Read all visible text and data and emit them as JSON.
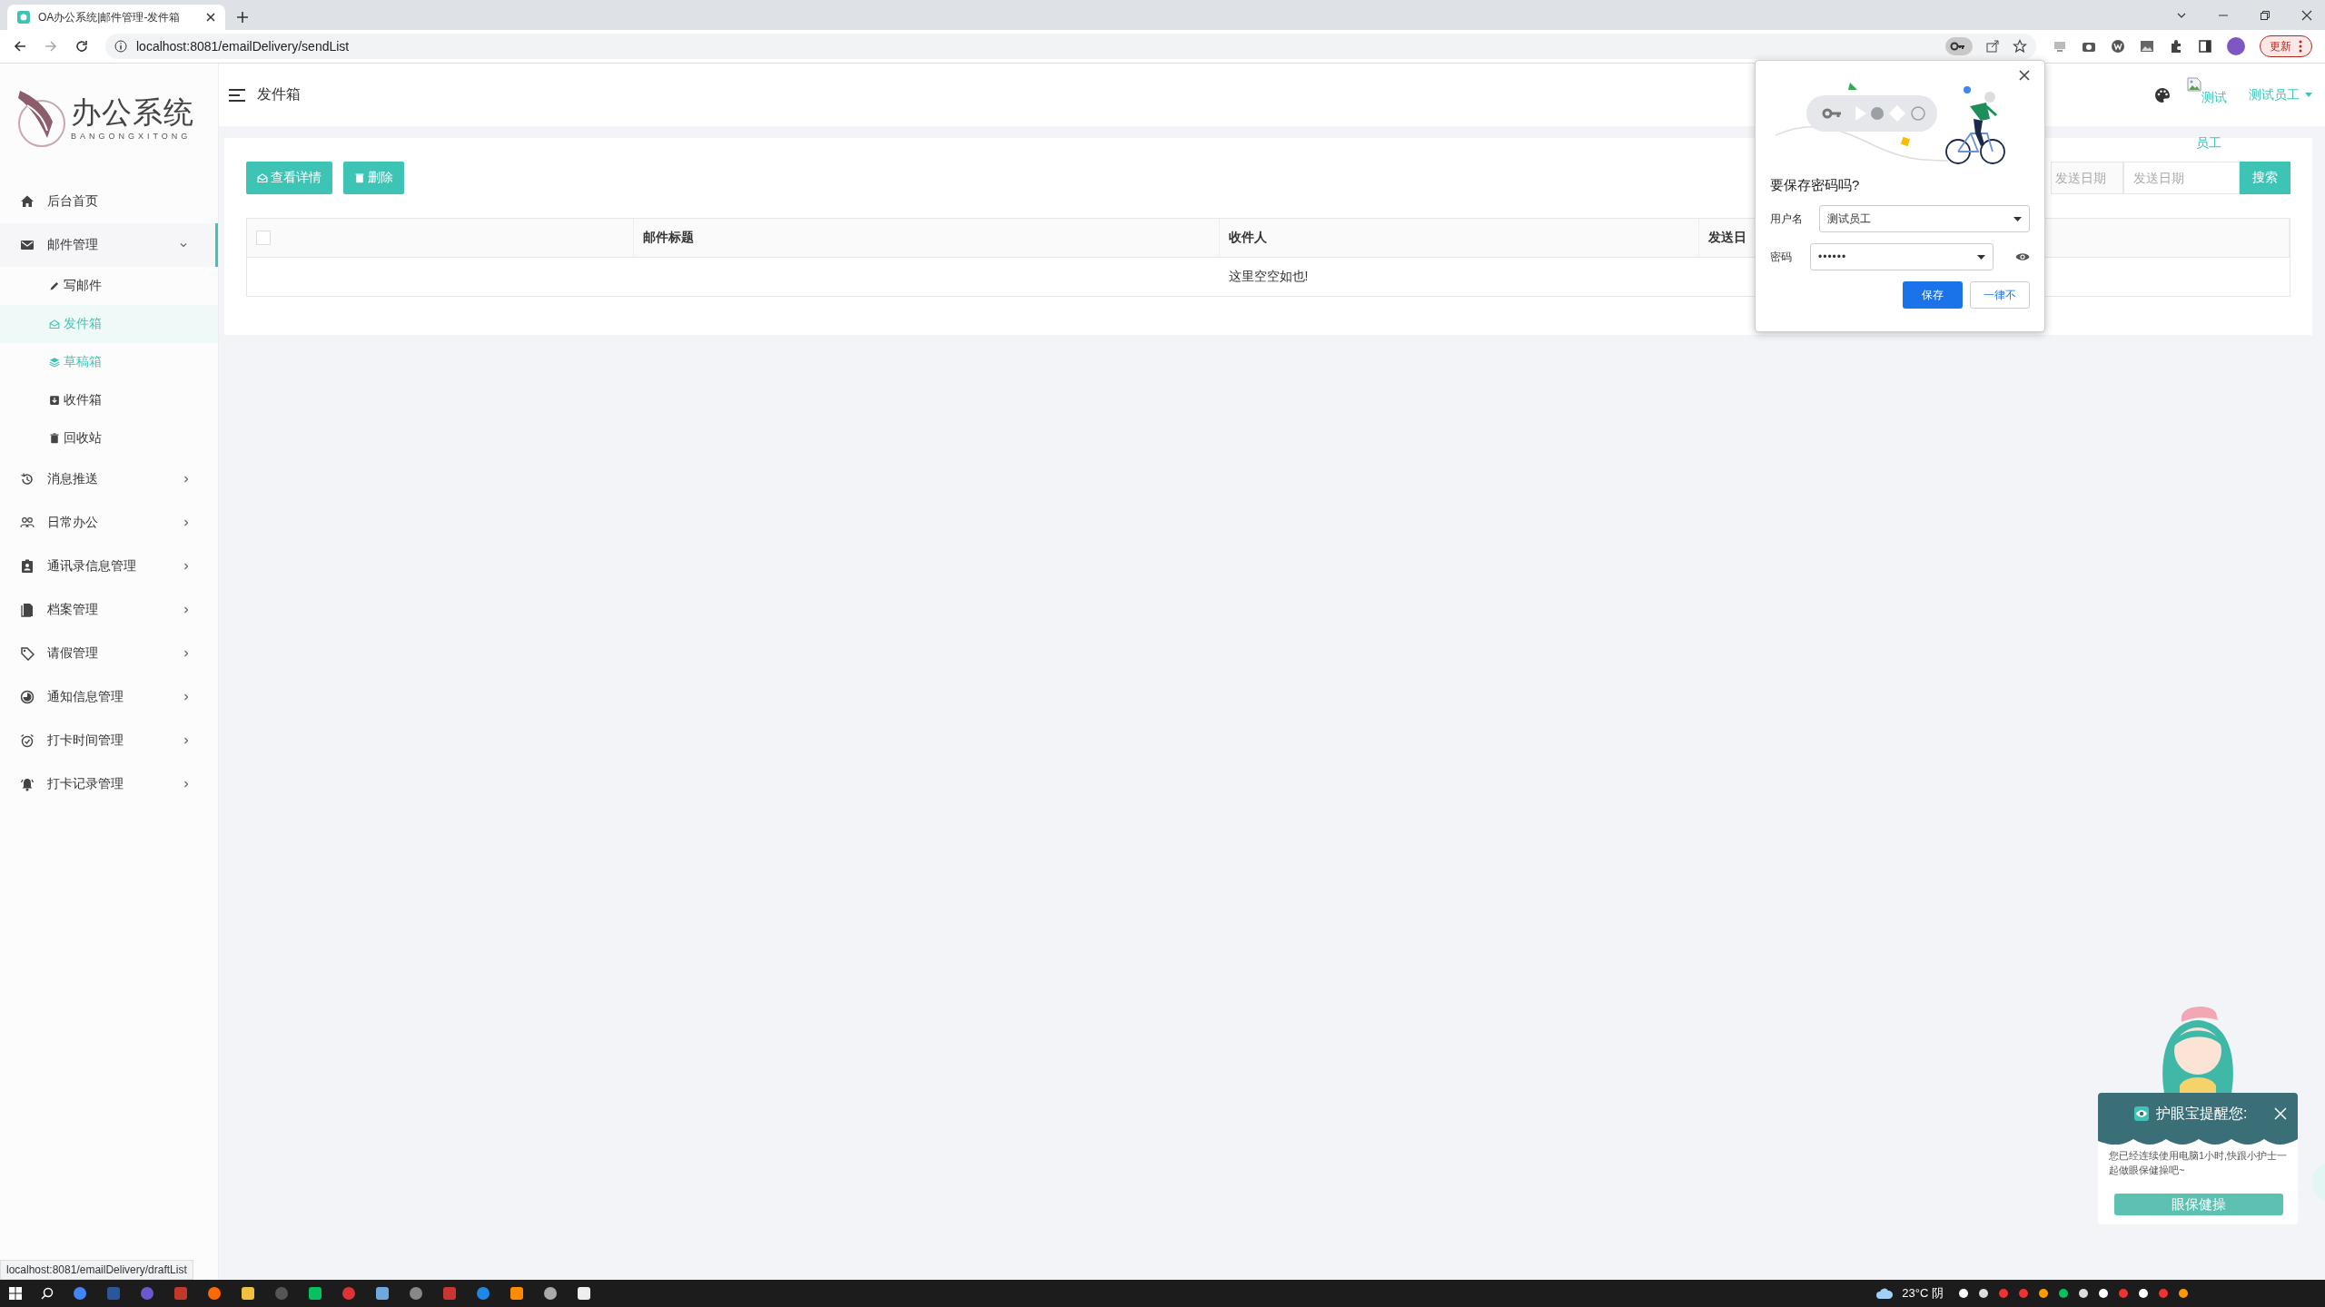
{
  "browser": {
    "tab_title": "OA办公系统|邮件管理-发件箱",
    "url": "localhost:8081/emailDelivery/sendList",
    "update_button": "更新"
  },
  "sidebar": {
    "logo": {
      "title": "办公系统",
      "subtitle": "BANGONGXITONG"
    },
    "items": [
      {
        "kind": "link",
        "label": "后台首页"
      },
      {
        "kind": "group",
        "label": "邮件管理",
        "expanded": true,
        "children": [
          {
            "label": "写邮件",
            "selected": false,
            "hovered": false
          },
          {
            "label": "发件箱",
            "selected": true,
            "hovered": false
          },
          {
            "label": "草稿箱",
            "selected": false,
            "hovered": true
          },
          {
            "label": "收件箱",
            "selected": false,
            "hovered": false
          },
          {
            "label": "回收站",
            "selected": false,
            "hovered": false
          }
        ]
      },
      {
        "kind": "group",
        "label": "消息推送",
        "expanded": false
      },
      {
        "kind": "group",
        "label": "日常办公",
        "expanded": false
      },
      {
        "kind": "group",
        "label": "通讯录信息管理",
        "expanded": false
      },
      {
        "kind": "group",
        "label": "档案管理",
        "expanded": false
      },
      {
        "kind": "group",
        "label": "请假管理",
        "expanded": false
      },
      {
        "kind": "group",
        "label": "通知信息管理",
        "expanded": false
      },
      {
        "kind": "group",
        "label": "打卡时间管理",
        "expanded": false
      },
      {
        "kind": "group",
        "label": "打卡记录管理",
        "expanded": false
      }
    ]
  },
  "header": {
    "title": "发件箱",
    "avatar_alt": [
      "测试",
      "员工"
    ],
    "user_name": "测试员工"
  },
  "toolbar": {
    "buttons": [
      {
        "label": "查看详情"
      },
      {
        "label": "删除"
      }
    ],
    "search_fields": [
      {
        "placeholder": "发送日期"
      },
      {
        "placeholder": "发送日期"
      }
    ],
    "search_button": "搜索"
  },
  "table": {
    "columns": [
      {
        "kind": "checkbox",
        "checked": false
      },
      {
        "kind": "text",
        "label": "邮件标题"
      },
      {
        "kind": "text",
        "label": "收件人"
      },
      {
        "kind": "text",
        "label": "发送日"
      }
    ],
    "empty_text": "这里空空如也!"
  },
  "password_dialog": {
    "title": "要保存密码吗?",
    "username_label": "用户名",
    "username": "测试员工",
    "password_label": "密码",
    "password": "••••••",
    "save_button": "保存",
    "never_button": "一律不"
  },
  "eye_care": {
    "title": "护眼宝提醒您:",
    "message": "您已经连续使用电脑1小时,快跟小护士一起做眼保健操吧~",
    "button": "眼保健操"
  },
  "status_link": "localhost:8081/emailDelivery/draftList",
  "taskbar": {
    "weather": "23°C 阴"
  }
}
